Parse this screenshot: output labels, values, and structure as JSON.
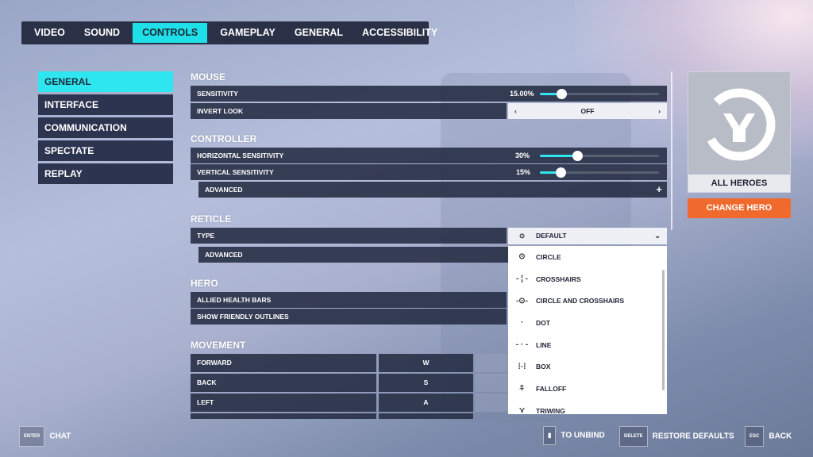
{
  "tabs": [
    "VIDEO",
    "SOUND",
    "CONTROLS",
    "GAMEPLAY",
    "GENERAL",
    "ACCESSIBILITY"
  ],
  "active_tab": "CONTROLS",
  "left_menu": [
    "GENERAL",
    "INTERFACE",
    "COMMUNICATION",
    "SPECTATE",
    "REPLAY"
  ],
  "sections": {
    "mouse": {
      "title": "MOUSE",
      "sensitivity_label": "SENSITIVITY",
      "sensitivity_value": "15.00%",
      "sensitivity_fill": 0.18,
      "invert_label": "INVERT LOOK",
      "invert_value": "OFF"
    },
    "controller": {
      "title": "CONTROLLER",
      "horizontal_label": "HORIZONTAL SENSITIVITY",
      "horizontal_value": "30%",
      "horizontal_fill": 0.31,
      "vertical_label": "VERTICAL SENSITIVITY",
      "vertical_value": "15%",
      "vertical_fill": 0.17,
      "advanced": "ADVANCED"
    },
    "reticle": {
      "title": "RETICLE",
      "type_label": "TYPE",
      "type_value": "DEFAULT",
      "advanced": "ADVANCED",
      "options": [
        {
          "icon": "⊙",
          "label": "CIRCLE"
        },
        {
          "icon": "- ¦ -",
          "label": "CROSSHAIRS"
        },
        {
          "icon": "-⊙-",
          "label": "CIRCLE AND CROSSHAIRS"
        },
        {
          "icon": "·",
          "label": "DOT"
        },
        {
          "icon": "- · -",
          "label": "LINE"
        },
        {
          "icon": "⁞·⁞",
          "label": "BOX"
        },
        {
          "icon": "⍏",
          "label": "FALLOFF"
        },
        {
          "icon": "⋎",
          "label": "TRIWING"
        }
      ]
    },
    "hero": {
      "title": "HERO",
      "allied": "ALLIED HEALTH BARS",
      "outlines": "SHOW FRIENDLY OUTLINES"
    },
    "movement": {
      "title": "MOVEMENT",
      "rows": [
        {
          "action": "FORWARD",
          "key": "W"
        },
        {
          "action": "BACK",
          "key": "S"
        },
        {
          "action": "LEFT",
          "key": "A"
        }
      ]
    }
  },
  "hero_card": {
    "name": "ALL HEROES",
    "change": "CHANGE HERO"
  },
  "footer": {
    "chat_key": "ENTER",
    "chat": "CHAT",
    "unbind": "TO UNBIND",
    "delete_key": "DELETE",
    "restore": "RESTORE DEFAULTS",
    "esc_key": "ESC",
    "back": "BACK"
  },
  "colors": {
    "accent": "#2ee6ef",
    "change_hero": "#f06a2e"
  }
}
